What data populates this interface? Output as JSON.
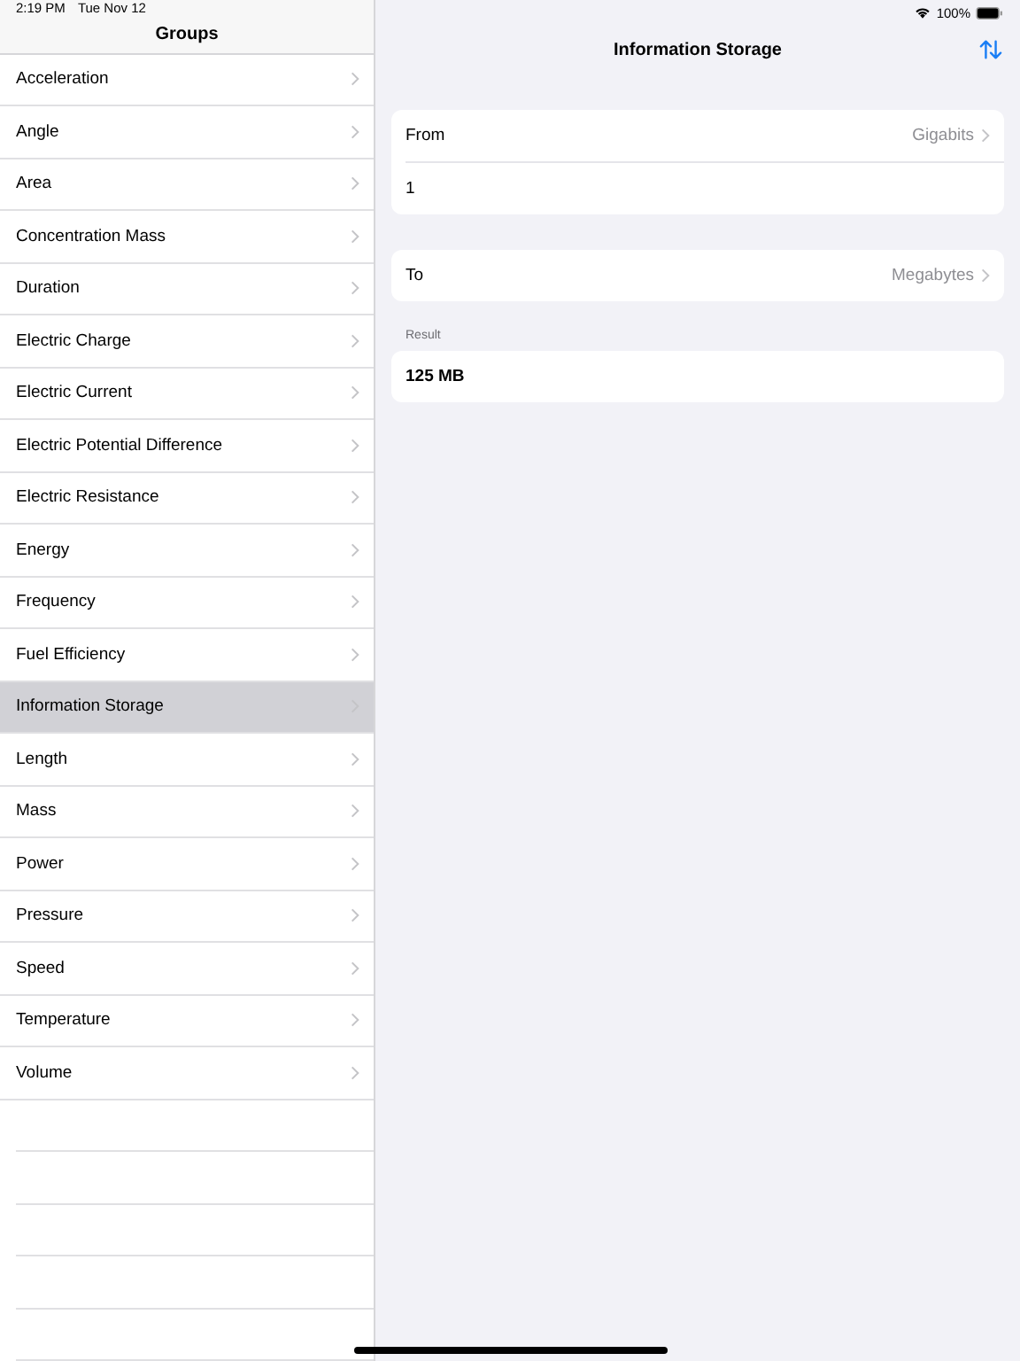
{
  "status_bar": {
    "time": "2:19 PM",
    "date": "Tue Nov 12",
    "battery": "100%"
  },
  "sidebar": {
    "title": "Groups",
    "items": [
      {
        "label": "Acceleration",
        "selected": false
      },
      {
        "label": "Angle",
        "selected": false
      },
      {
        "label": "Area",
        "selected": false
      },
      {
        "label": "Concentration Mass",
        "selected": false
      },
      {
        "label": "Duration",
        "selected": false
      },
      {
        "label": "Electric Charge",
        "selected": false
      },
      {
        "label": "Electric Current",
        "selected": false
      },
      {
        "label": "Electric Potential Difference",
        "selected": false
      },
      {
        "label": "Electric Resistance",
        "selected": false
      },
      {
        "label": "Energy",
        "selected": false
      },
      {
        "label": "Frequency",
        "selected": false
      },
      {
        "label": "Fuel Efficiency",
        "selected": false
      },
      {
        "label": "Information Storage",
        "selected": true
      },
      {
        "label": "Length",
        "selected": false
      },
      {
        "label": "Mass",
        "selected": false
      },
      {
        "label": "Power",
        "selected": false
      },
      {
        "label": "Pressure",
        "selected": false
      },
      {
        "label": "Speed",
        "selected": false
      },
      {
        "label": "Temperature",
        "selected": false
      },
      {
        "label": "Volume",
        "selected": false
      }
    ]
  },
  "detail": {
    "title": "Information Storage",
    "from": {
      "label": "From",
      "unit": "Gigabits",
      "value": "1"
    },
    "to": {
      "label": "To",
      "unit": "Megabytes"
    },
    "result": {
      "header": "Result",
      "value": "125 MB"
    }
  }
}
